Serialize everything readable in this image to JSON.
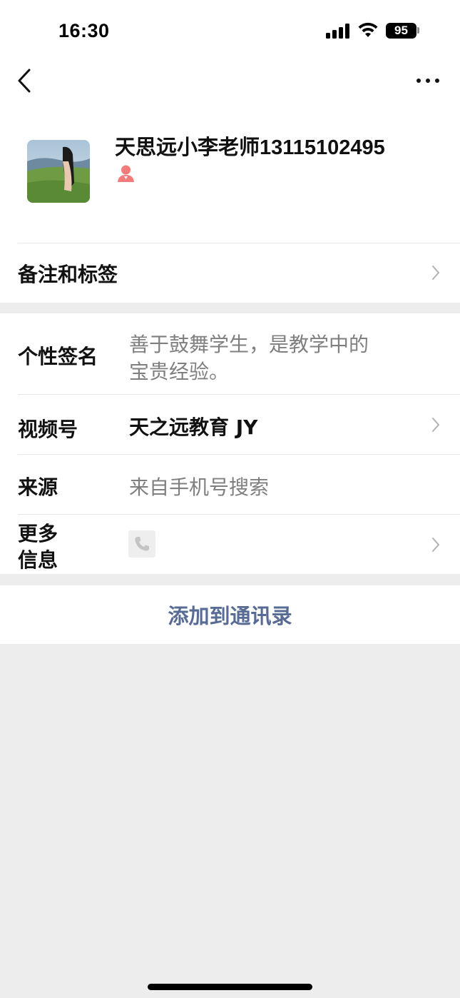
{
  "status_bar": {
    "time": "16:30",
    "battery": "95",
    "icons": [
      "signal-icon",
      "wifi-icon",
      "battery-icon"
    ]
  },
  "nav": {
    "back_icon": "chevron-left-icon",
    "more_icon": "more-horizontal-icon"
  },
  "profile": {
    "name": "天思远小李老师13115102495",
    "gender_icon": "female-icon",
    "gender_color": "#f37b7b"
  },
  "rows": {
    "remark_label": "备注和标签",
    "signature_label": "个性签名",
    "signature_line1": "善于鼓舞学生，是教学中的",
    "signature_line2": "宝贵经验。",
    "channels_label": "视频号",
    "channels_value": "天之远教育 JY",
    "source_label": "来源",
    "source_value": "来自手机号搜索",
    "more_label_line1": "更多",
    "more_label_line2": "信息",
    "more_icon": "phone-icon"
  },
  "actions": {
    "add_to_contacts": "添加到通讯录"
  },
  "colors": {
    "accent": "#576b95",
    "background": "#ededed",
    "secondary_text": "#7f7f7f"
  }
}
